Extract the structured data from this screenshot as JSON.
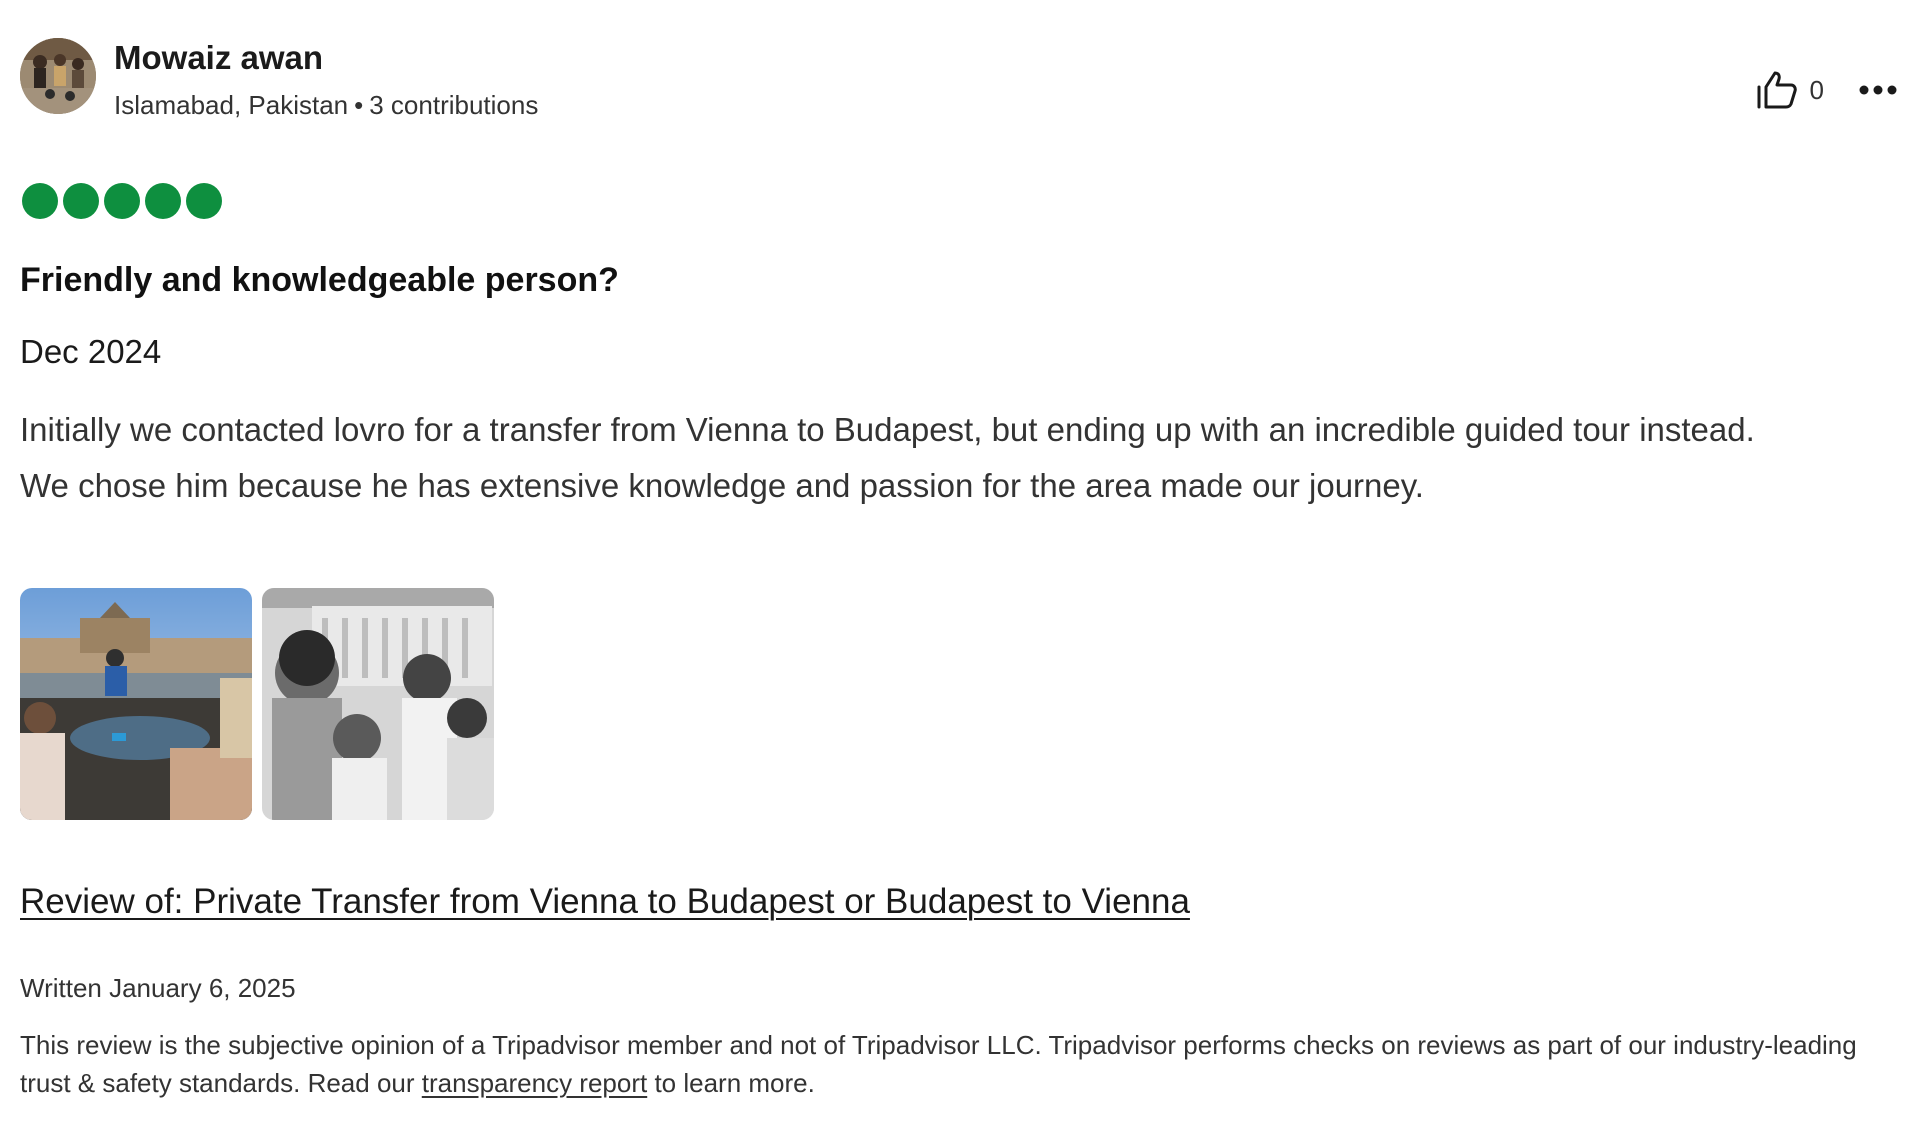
{
  "colors": {
    "rating_bubble": "#0e8f3f",
    "text_primary": "#1a1a1a",
    "text_secondary": "#333333"
  },
  "user": {
    "name": "Mowaiz awan",
    "location": "Islamabad, Pakistan",
    "separator": "•",
    "contributions": "3 contributions",
    "avatar_icon": "user-avatar-photo"
  },
  "actions": {
    "helpful_icon": "thumbs-up-icon",
    "helpful_count": "0",
    "more_icon": "more-options-icon"
  },
  "review": {
    "rating": 5,
    "rating_max": 5,
    "title": "Friendly and knowledgeable person?",
    "date_of_experience": "Dec 2024",
    "body_line1": "Initially we contacted lovro for a transfer from Vienna to Budapest, but ending up with an incredible guided tour instead.",
    "body_line2": "We chose him because he has extensive knowledge and passion for the area made our journey.",
    "photos": [
      {
        "icon": "photo-thumbnail-boat-budapest"
      },
      {
        "icon": "photo-thumbnail-family-selfie"
      }
    ],
    "review_of": "Review of: Private Transfer from Vienna to Budapest or Budapest to Vienna",
    "written": "Written January 6, 2025"
  },
  "disclaimer": {
    "text_before": "This review is the subjective opinion of a Tripadvisor member and not of Tripadvisor LLC. Tripadvisor performs checks on reviews as part of our industry-leading trust & safety standards. Read our ",
    "link": "transparency report",
    "text_after": " to learn more."
  }
}
